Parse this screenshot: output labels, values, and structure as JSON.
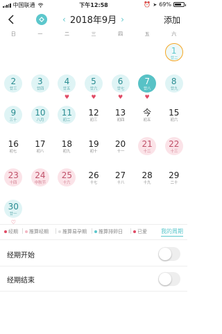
{
  "status_bar": {
    "carrier": "中国联通",
    "time": "下午12:58",
    "battery": "69%",
    "battery_level": 0.69
  },
  "nav": {
    "month_title": "2018年9月",
    "prev_symbol": "‹",
    "next_symbol": "›",
    "add_label": "添加"
  },
  "weekdays": [
    "日",
    "一",
    "二",
    "三",
    "四",
    "五",
    "六"
  ],
  "calendar": {
    "days": [
      {
        "day": "1",
        "lunar": "廿二",
        "style": "today-ring"
      },
      {
        "day": "2",
        "lunar": "廿三",
        "style": "teal"
      },
      {
        "day": "3",
        "lunar": "廿四",
        "style": "teal"
      },
      {
        "day": "4",
        "lunar": "廿五",
        "style": "teal",
        "heart": true
      },
      {
        "day": "5",
        "lunar": "廿六",
        "style": "teal",
        "heart": true
      },
      {
        "day": "6",
        "lunar": "廿七",
        "style": "teal",
        "heart": true
      },
      {
        "day": "7",
        "lunar": "廿八",
        "style": "teal-strong",
        "heart": true
      },
      {
        "day": "8",
        "lunar": "廿九",
        "style": "teal"
      },
      {
        "day": "9",
        "lunar": "三十",
        "style": "teal"
      },
      {
        "day": "10",
        "lunar": "八月",
        "style": "teal"
      },
      {
        "day": "11",
        "lunar": "初二",
        "style": "teal"
      },
      {
        "day": "12",
        "lunar": "初三",
        "style": ""
      },
      {
        "day": "13",
        "lunar": "初四",
        "style": ""
      },
      {
        "day": "今",
        "lunar": "初五",
        "style": ""
      },
      {
        "day": "15",
        "lunar": "初六",
        "style": ""
      },
      {
        "day": "16",
        "lunar": "初七",
        "style": ""
      },
      {
        "day": "17",
        "lunar": "初八",
        "style": ""
      },
      {
        "day": "18",
        "lunar": "初九",
        "style": ""
      },
      {
        "day": "19",
        "lunar": "初十",
        "style": ""
      },
      {
        "day": "20",
        "lunar": "十一",
        "style": ""
      },
      {
        "day": "21",
        "lunar": "十二",
        "style": "pink"
      },
      {
        "day": "22",
        "lunar": "十三",
        "style": "pink"
      },
      {
        "day": "23",
        "lunar": "十四",
        "style": "pink"
      },
      {
        "day": "24",
        "lunar": "中秋节",
        "style": "pink"
      },
      {
        "day": "25",
        "lunar": "十六",
        "style": "pink"
      },
      {
        "day": "26",
        "lunar": "十七",
        "style": ""
      },
      {
        "day": "27",
        "lunar": "十八",
        "style": ""
      },
      {
        "day": "28",
        "lunar": "十九",
        "style": ""
      },
      {
        "day": "29",
        "lunar": "二十",
        "style": ""
      },
      {
        "day": "30",
        "lunar": "廿一",
        "style": "teal",
        "heart_outline": true
      }
    ]
  },
  "legend": {
    "items": [
      {
        "label": "经期",
        "color": "#e04b65"
      },
      {
        "label": "推算经期",
        "color": "#f3b8c4"
      },
      {
        "label": "推算易孕期",
        "color": "#dddddd"
      },
      {
        "label": "推算排卵日",
        "color": "#5cc7cc"
      },
      {
        "label": "已爱",
        "color": "#e04b65"
      }
    ],
    "mine_label": "我的周期"
  },
  "settings": {
    "period_start_label": "经期开始",
    "period_end_label": "经期结束"
  },
  "colors": {
    "accent": "#5cc7cc",
    "period_pink": "#fbe3e8",
    "heart": "#e04b65",
    "today_ring": "#f5a623"
  }
}
